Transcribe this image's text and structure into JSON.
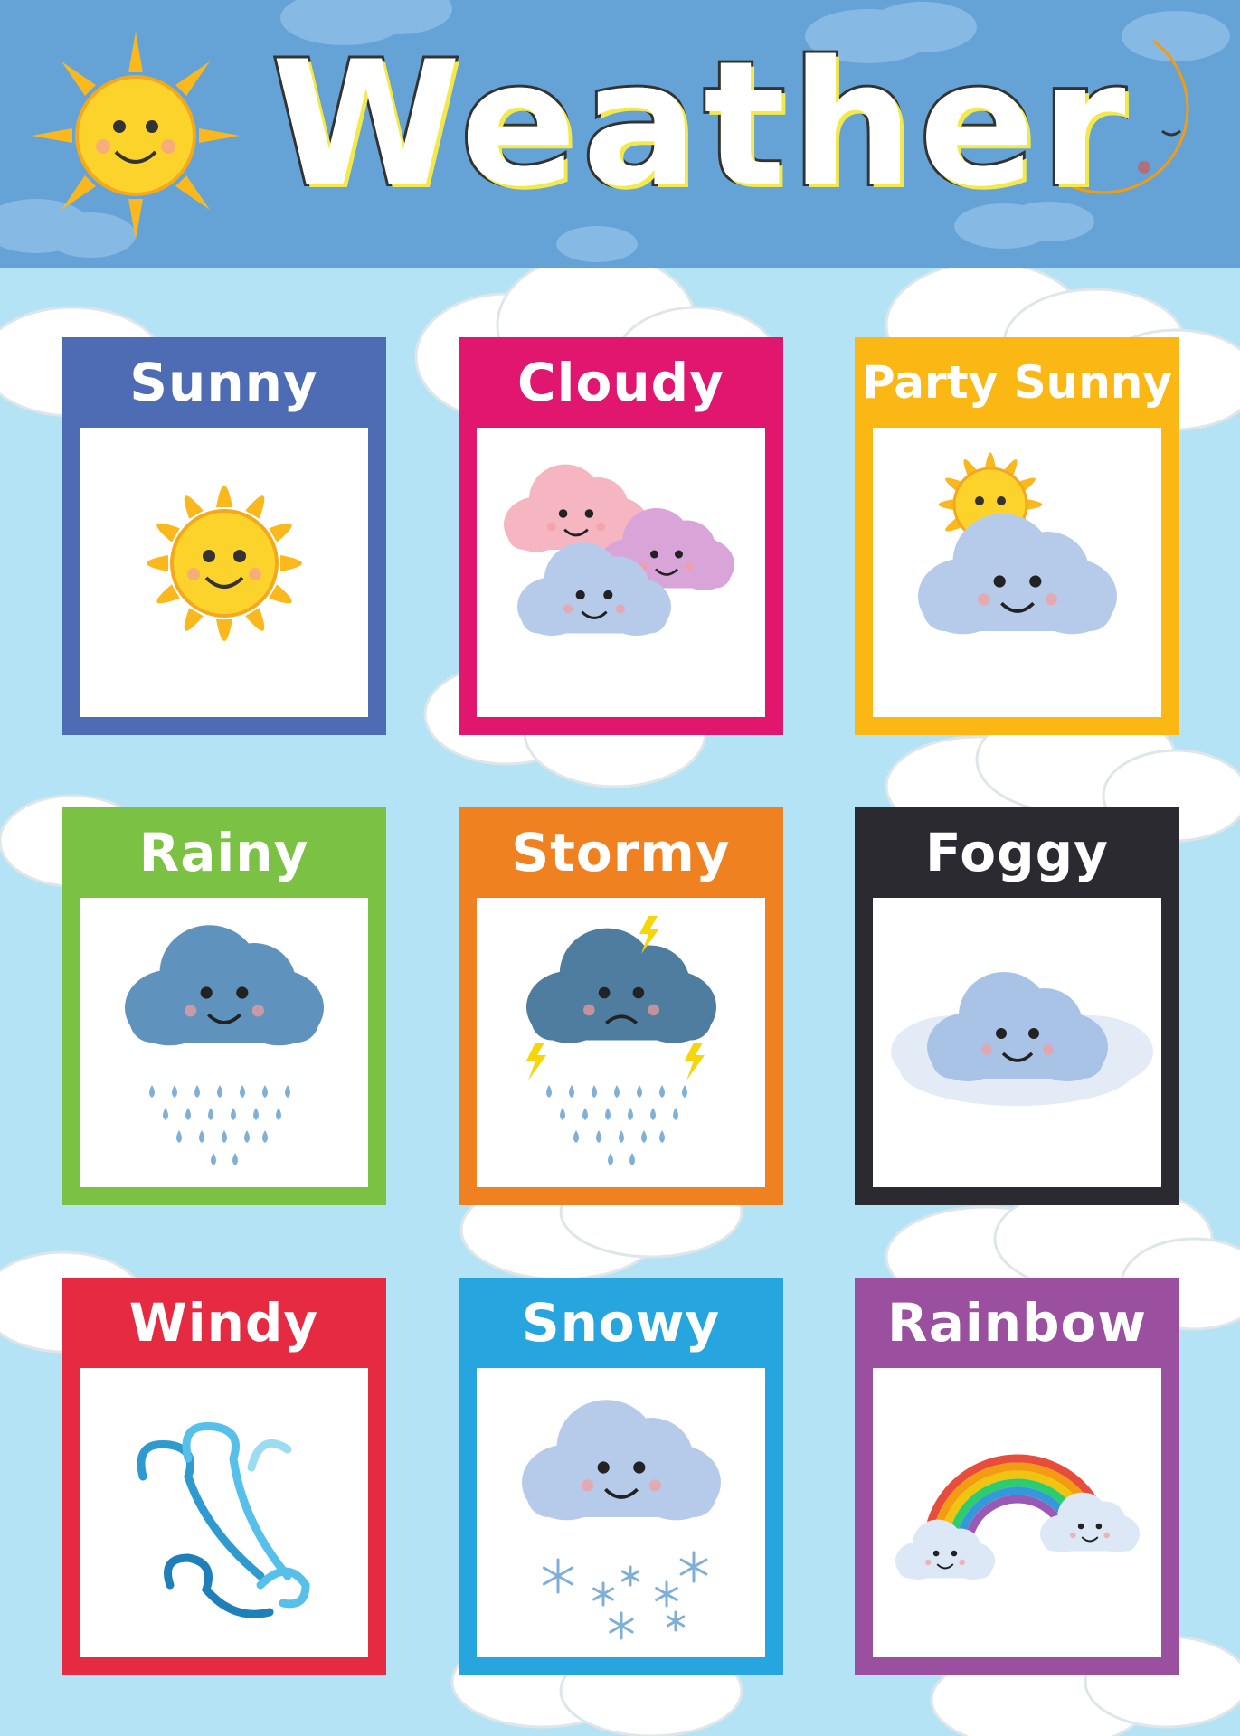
{
  "title": "Weather",
  "colors": {
    "header": "#65a2d5",
    "background": "#b3e3f4"
  },
  "cards": [
    {
      "label": "Sunny",
      "color": "#4e6cb3",
      "icon": "sun-icon"
    },
    {
      "label": "Cloudy",
      "color": "#e0166f",
      "icon": "clouds-icon"
    },
    {
      "label": "Party Sunny",
      "color": "#fbb814",
      "icon": "partly-sunny-icon"
    },
    {
      "label": "Rainy",
      "color": "#7bc143",
      "icon": "rain-cloud-icon"
    },
    {
      "label": "Stormy",
      "color": "#f08120",
      "icon": "storm-cloud-icon"
    },
    {
      "label": "Foggy",
      "color": "#2a2a30",
      "icon": "fog-cloud-icon"
    },
    {
      "label": "Windy",
      "color": "#e52a41",
      "icon": "wind-icon"
    },
    {
      "label": "Snowy",
      "color": "#27a5df",
      "icon": "snow-cloud-icon"
    },
    {
      "label": "Rainbow",
      "color": "#9b4f9f",
      "icon": "rainbow-icon"
    }
  ]
}
